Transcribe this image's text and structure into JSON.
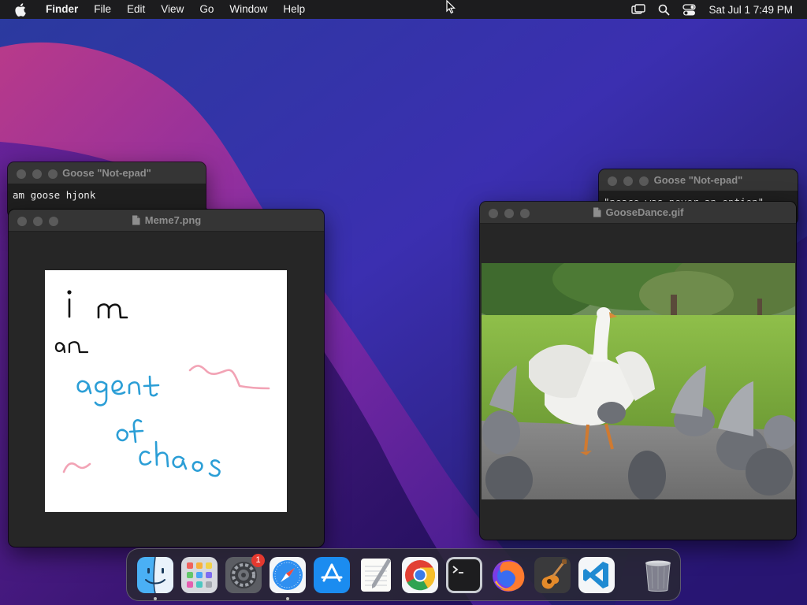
{
  "menubar": {
    "app_name": "Finder",
    "items": [
      "File",
      "Edit",
      "View",
      "Go",
      "Window",
      "Help"
    ],
    "clock": "Sat Jul 1  7:49 PM",
    "status_icons": [
      "screen-mirroring-icon",
      "search-icon",
      "control-center-icon"
    ]
  },
  "windows": {
    "note1": {
      "title": "Goose \"Not-epad\"",
      "text": "am goose hjonk"
    },
    "note2": {
      "title": "Goose \"Not-epad\"",
      "text": "\"peace was never an option\""
    },
    "meme": {
      "title": "Meme7.png",
      "handwriting": [
        "i m",
        "an",
        "agent",
        "of",
        "chaos"
      ]
    },
    "gif": {
      "title": "GooseDance.gif"
    }
  },
  "dock": {
    "apps": [
      {
        "name": "finder-icon",
        "running": true
      },
      {
        "name": "launchpad-icon",
        "running": false
      },
      {
        "name": "system-settings-icon",
        "running": false,
        "badge": "1"
      },
      {
        "name": "safari-icon",
        "running": true
      },
      {
        "name": "app-store-icon",
        "running": false
      },
      {
        "name": "textedit-icon",
        "running": false
      },
      {
        "name": "chrome-icon",
        "running": false
      },
      {
        "name": "terminal-icon",
        "running": false
      },
      {
        "name": "firefox-icon",
        "running": false
      },
      {
        "name": "garageband-icon",
        "running": false
      },
      {
        "name": "vscode-icon",
        "running": false
      },
      {
        "name": "trash-icon",
        "running": false
      }
    ]
  },
  "colors": {
    "menubar_bg": "#1c1c1e",
    "window_bg": "#262626",
    "meme_blue": "#2b9ed6",
    "meme_pink": "#f2a3b5"
  }
}
